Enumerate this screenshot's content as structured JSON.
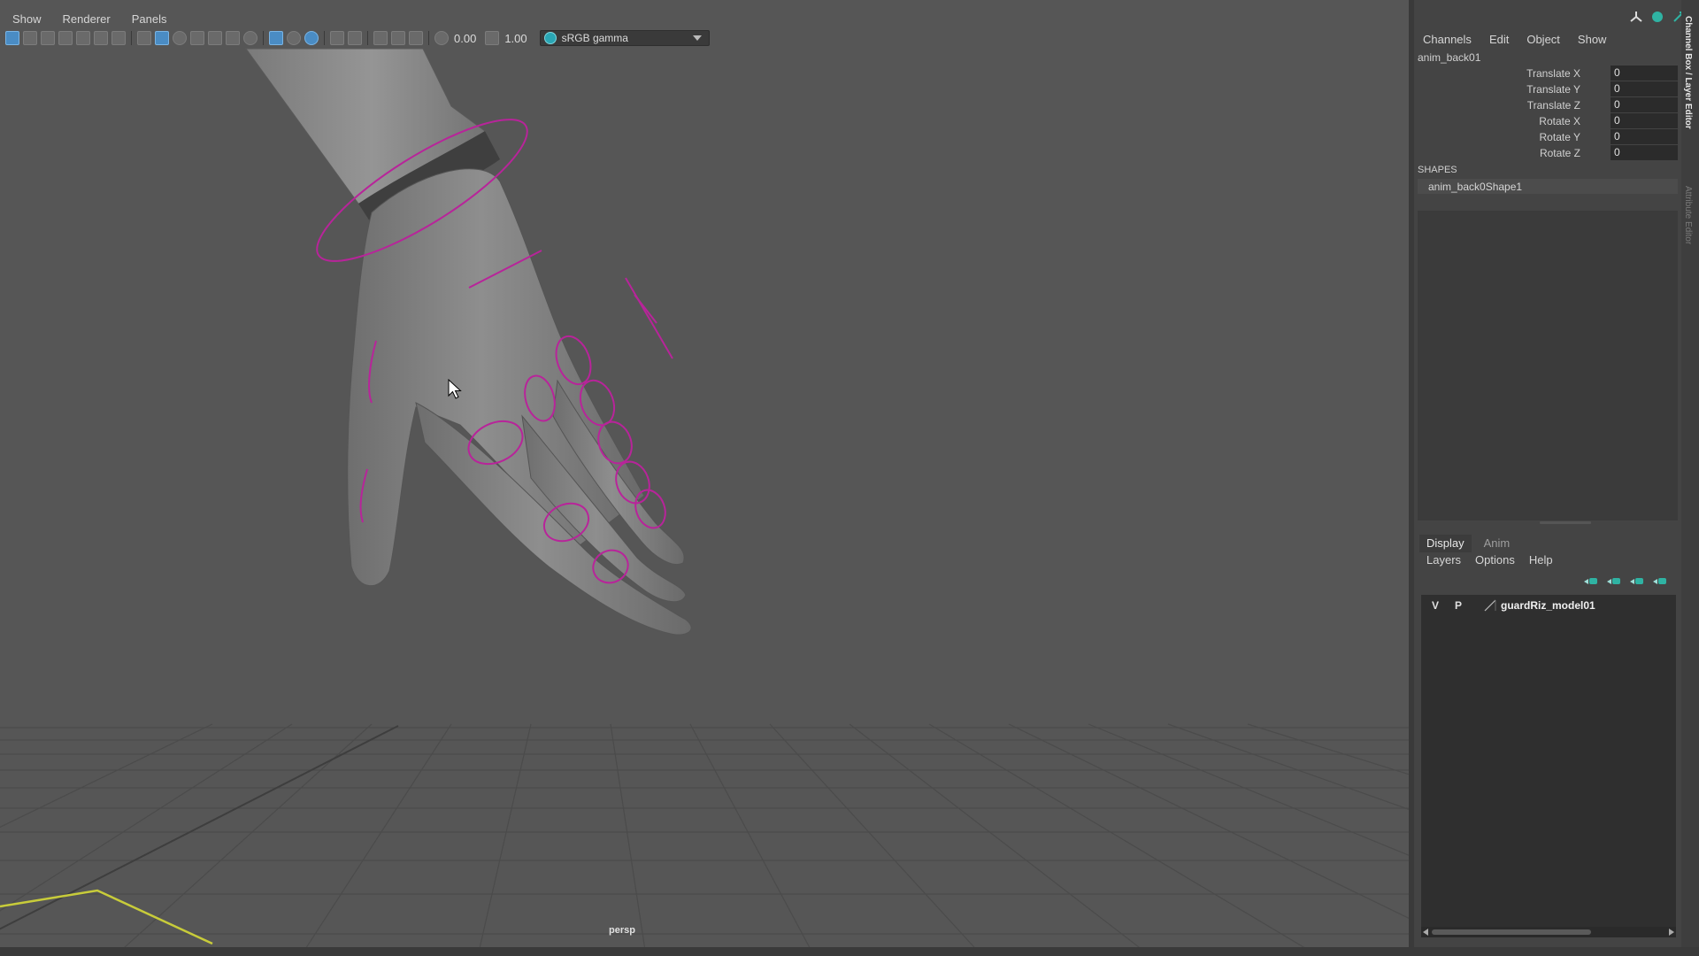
{
  "viewport": {
    "menu": [
      "Show",
      "Renderer",
      "Panels"
    ],
    "exposure_value": "0.00",
    "gamma_value": "1.00",
    "color_management": "sRGB gamma",
    "camera_label": "persp"
  },
  "channel_box": {
    "menu": [
      "Channels",
      "Edit",
      "Object",
      "Show"
    ],
    "object_name": "anim_back01",
    "channels": [
      {
        "label": "Translate X",
        "value": "0"
      },
      {
        "label": "Translate Y",
        "value": "0"
      },
      {
        "label": "Translate Z",
        "value": "0"
      },
      {
        "label": "Rotate X",
        "value": "0"
      },
      {
        "label": "Rotate Y",
        "value": "0"
      },
      {
        "label": "Rotate Z",
        "value": "0"
      }
    ],
    "shapes_header": "SHAPES",
    "shape_name": "anim_back0Shape1"
  },
  "layer_editor": {
    "tabs": [
      "Display",
      "Anim"
    ],
    "menu": [
      "Layers",
      "Options",
      "Help"
    ],
    "layers": [
      {
        "visible": "V",
        "playback": "P",
        "name": "guardRiz_model01"
      }
    ]
  },
  "side_tabs": {
    "channel_box": "Channel Box / Layer Editor",
    "attribute_editor": "Attribute Editor"
  },
  "colors": {
    "viewport_bg": "#565656",
    "control_curve": "#b8249a",
    "grid_line": "#4a4a4a",
    "axis_x": "#c8cc3a",
    "selection_blue": "#4a8cc4"
  }
}
